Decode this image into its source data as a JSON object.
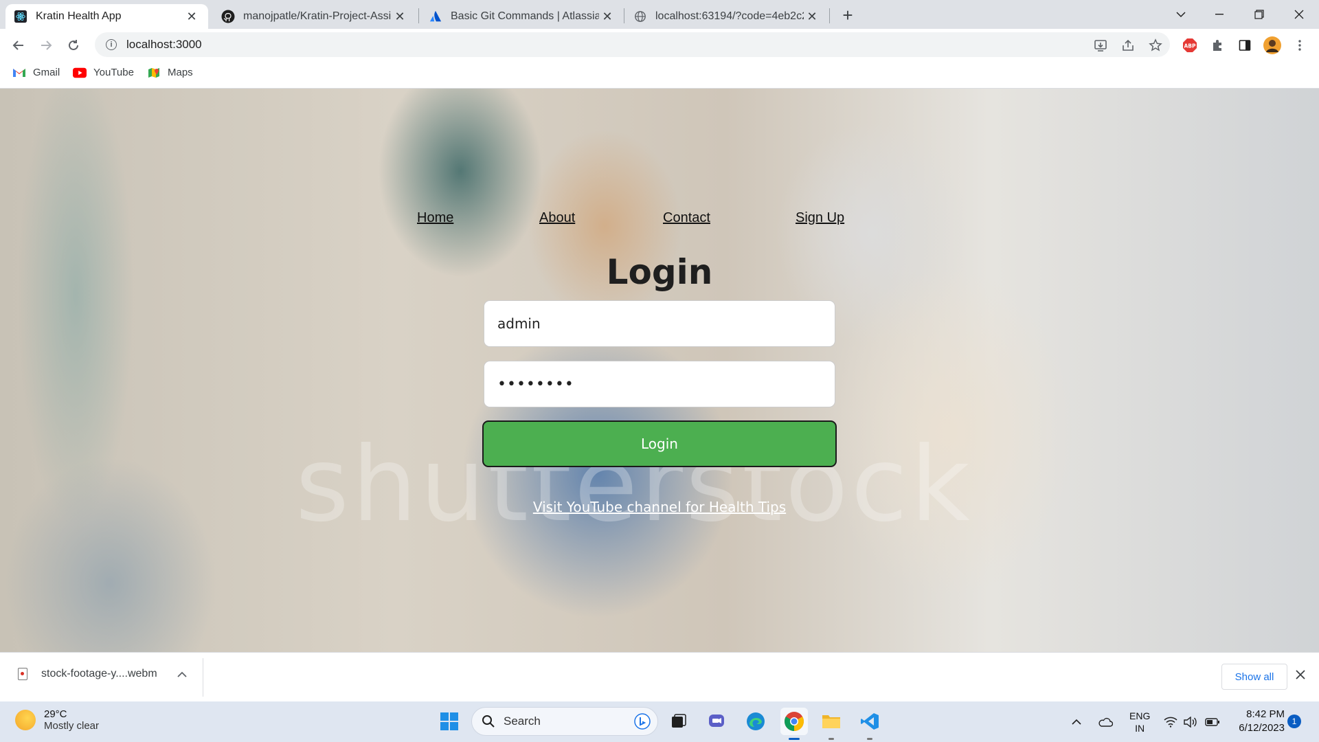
{
  "browser": {
    "tabs": [
      {
        "title": "Kratin Health App",
        "active": true
      },
      {
        "title": "manojpatle/Kratin-Project-Assign",
        "active": false
      },
      {
        "title": "Basic Git Commands | Atlassian G",
        "active": false
      },
      {
        "title": "localhost:63194/?code=4eb2c2cc",
        "active": false
      }
    ],
    "new_tab": "+",
    "url": "localhost:3000",
    "bookmarks": [
      {
        "label": "Gmail"
      },
      {
        "label": "YouTube"
      },
      {
        "label": "Maps"
      }
    ]
  },
  "page": {
    "nav": {
      "home": "Home",
      "about": "About",
      "contact": "Contact",
      "signup": "Sign Up"
    },
    "title": "Login",
    "username_value": "admin",
    "password_value": "••••••••",
    "login_button": "Login",
    "youtube_link": "Visit YouTube channel for Health Tips",
    "watermark": "shutterstock"
  },
  "downloads": {
    "file_name": "stock-footage-y....webm",
    "show_all": "Show all"
  },
  "taskbar": {
    "temperature": "29°C",
    "weather": "Mostly clear",
    "search_placeholder": "Search",
    "language": "ENG",
    "region": "IN",
    "time": "8:42 PM",
    "date": "6/12/2023",
    "notification_count": "1"
  },
  "colors": {
    "login_button": "#4caf50",
    "link_text": "#ffffff",
    "chrome_tabstrip": "#dee1e6",
    "taskbar": "#dfe6f1"
  }
}
